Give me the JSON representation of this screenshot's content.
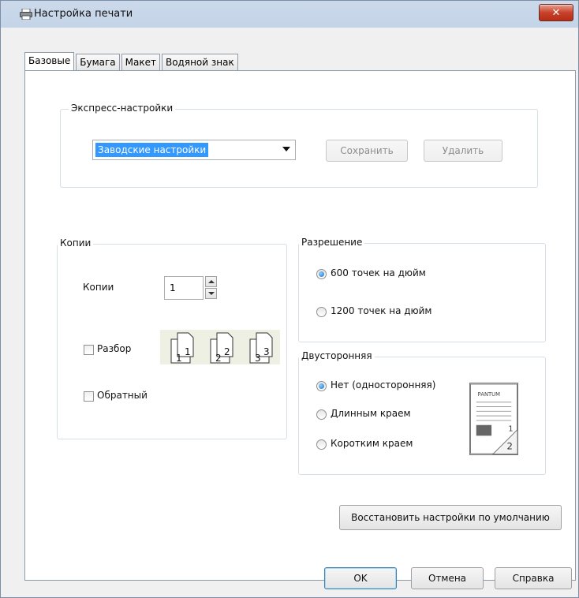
{
  "window": {
    "title": "Настройка печати",
    "close_label": "✕"
  },
  "tabs": [
    {
      "label": "Базовые",
      "active": true
    },
    {
      "label": "Бумага",
      "active": false
    },
    {
      "label": "Макет",
      "active": false
    },
    {
      "label": "Водяной знак",
      "active": false
    }
  ],
  "express": {
    "legend": "Экспресс-настройки",
    "selected": "Заводские настройки",
    "save_label": "Сохранить",
    "delete_label": "Удалить"
  },
  "copies": {
    "legend": "Копии",
    "copies_label": "Копии",
    "copies_value": "1",
    "collate_label": "Разбор",
    "collate_checked": false,
    "reverse_label": "Обратный",
    "reverse_checked": false,
    "collate_pages": [
      "1",
      "1",
      "2",
      "2",
      "3",
      "3"
    ]
  },
  "resolution": {
    "legend": "Разрешение",
    "options": [
      "600 точек на дюйм",
      "1200 точек на дюйм"
    ],
    "selected_index": 0
  },
  "duplex": {
    "legend": "Двусторонняя",
    "options": [
      "Нет (односторонняя)",
      "Длинным краем",
      "Коротким краем"
    ],
    "selected_index": 0,
    "preview_brand": "PANTUM",
    "preview_page_numbers": [
      "1",
      "2"
    ]
  },
  "restore_label": "Восстановить настройки по умолчанию",
  "footer": {
    "ok_label": "OK",
    "cancel_label": "Отмена",
    "help_label": "Справка"
  },
  "colors": {
    "close_button": "#c7412b",
    "selection": "#3399ff",
    "radio_checked": "#1a6fc4"
  }
}
